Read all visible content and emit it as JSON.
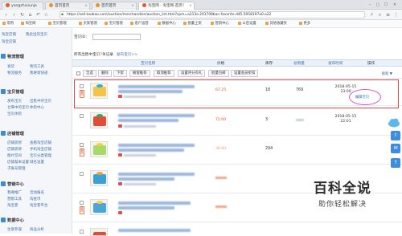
{
  "browser": {
    "tabs": [
      {
        "label": "yangzhixiunje",
        "color": "#e05a2b"
      },
      {
        "label": "首页首页",
        "color": "#e7932c"
      },
      {
        "label": "首页首页",
        "color": "#e7932c"
      },
      {
        "label": "淘宝网 - 淘宝网-首页！",
        "color": "#e05a2b"
      }
    ],
    "url": "https://sell.taobao.com/auction/merchandise/auction_list.htm?spm=a313o.201708ban.favorite.d45.5058197a0.a22",
    "bookmarks": [
      "常用",
      "淘宝网",
      "宝贝管理",
      "买家管理",
      "宝贝管理",
      "客户运营",
      "数据中心",
      "批量上架",
      "营销中心",
      "以后设置",
      "其他收藏夹",
      "更多"
    ]
  },
  "sidebar": {
    "top_links": [
      [
        "淘宝店铺",
        "我卖出的宝贝"
      ],
      [
        "淘宝店铺"
      ]
    ],
    "sections": [
      {
        "title": "物流管理",
        "color": "#3f8ad8",
        "links": [
          [
            "发货",
            "物流工具"
          ],
          [
            "物流服务",
            "我要寄快递"
          ]
        ]
      },
      {
        "title": "宝贝管理",
        "color": "#3f8ad8",
        "links": [
          [
            "发布宝贝",
            "出售中的宝贝"
          ],
          [
            "仓库中的宝贝",
            "体检中心"
          ],
          [
            "宝贝体检"
          ]
        ]
      },
      {
        "title": "店铺管理",
        "color": "#3f8ad8",
        "links": [
          [
            "店铺装修",
            "查看淘宝店铺"
          ],
          [
            "店铺装修",
            "手机淘宝店铺"
          ],
          [
            "图片空间",
            "宝贝分类管理"
          ],
          [
            "店铺基本设置",
            "域名设置"
          ],
          [
            "子账号管理"
          ]
        ]
      },
      {
        "title": "营销中心",
        "color": "#3f8ad8",
        "links": [
          [
            "我要推广",
            "活动报名"
          ],
          [
            "营销工具",
            "淘金币"
          ],
          [
            "淘宝客",
            "淘宝客平台"
          ]
        ]
      },
      {
        "title": "数据中心",
        "color": "#3f8ad8",
        "links": [
          [
            "生意参谋",
            "商品分析"
          ]
        ]
      }
    ]
  },
  "main": {
    "search_label": "宝贝ID：",
    "summary_prefix": "所有出售中宝贝",
    "summary_count": "7",
    "summary_suffix": "条记录",
    "summary_link": "发布宝贝>>",
    "headers": [
      "宝贝名称",
      "价格",
      "库存",
      "总销量",
      "发布时间",
      "操作"
    ],
    "toolbar_buttons": [
      "全选",
      "删除",
      "下架",
      "橱窗推荐",
      "取消推荐",
      "设置评分有礼",
      "批量包邮",
      "设置会员折扣"
    ],
    "toolbar_right": "搜索 ▼",
    "rows": [
      {
        "badge": "新品",
        "price": "67.25",
        "stock": "18",
        "sales": "769",
        "date": "2018-05-15",
        "time": "23:00",
        "action": "编辑宝贝",
        "highlight": true
      },
      {
        "badge": "",
        "price": "72.00",
        "stock": "3",
        "sales": "",
        "date": "2018-05-15",
        "time": "22:01",
        "action": "",
        "highlight": false
      },
      {
        "badge": "新品",
        "price": "39.60",
        "stock": "294",
        "sales": "",
        "date": "",
        "time": "",
        "action": "",
        "highlight": false
      },
      {
        "badge": "",
        "price": "",
        "stock": "",
        "sales": "",
        "date": "",
        "time": "",
        "action": "",
        "highlight": false
      },
      {
        "badge": "新品",
        "price": "",
        "stock": "",
        "sales": "",
        "date": "",
        "time": "",
        "action": "",
        "highlight": false
      }
    ]
  },
  "watermark": {
    "main": "百科全说",
    "sub": "助你轻松解决"
  },
  "colors": {
    "accent": "#3d6fb0",
    "price": "#e0512b",
    "highlight_box": "#e24a4a",
    "oval": "#d05ac4"
  }
}
